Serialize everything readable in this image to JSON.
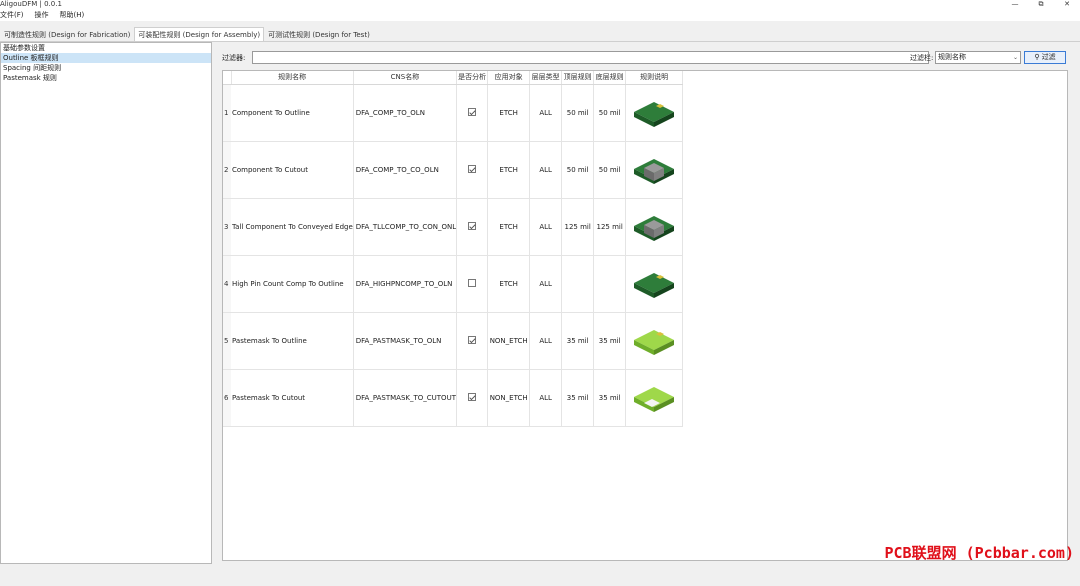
{
  "window": {
    "title": "AligouDFM | 0.0.1",
    "minimize": "—",
    "maximize": "⧉",
    "close": "✕"
  },
  "menu": [
    "文件(F)",
    "操作",
    "帮助(H)"
  ],
  "tabs": [
    {
      "label": "可制造性规则 (Design for Fabrication)",
      "active": false
    },
    {
      "label": "可装配性规则 (Design for Assembly)",
      "active": true
    },
    {
      "label": "可测试性规则 (Design for Test)",
      "active": false
    }
  ],
  "sidebar": {
    "items": [
      {
        "label": "基础参数设置",
        "selected": false
      },
      {
        "label": "Outline 板框规则",
        "selected": true
      },
      {
        "label": "Spacing 间距规则",
        "selected": false
      },
      {
        "label": "Pastemask 规则",
        "selected": false
      }
    ]
  },
  "filter": {
    "label": "过滤器:",
    "value": "",
    "column_label": "过滤栏:",
    "column_value": "规则名称",
    "button": "过滤"
  },
  "table": {
    "headers": [
      "规则名称",
      "CNS名称",
      "是否分析",
      "应用对象",
      "层层类型",
      "顶层规则",
      "底层规则",
      "规则说明"
    ],
    "rows": [
      {
        "num": "1",
        "name": "Component To Outline",
        "cns": "DFA_COMP_TO_OLN",
        "checked": true,
        "target": "ETCH",
        "layer": "ALL",
        "top": "50 mil",
        "bottom": "50 mil",
        "icon": "dark-green-board-icon"
      },
      {
        "num": "2",
        "name": "Component To Cutout",
        "cns": "DFA_COMP_TO_CO_OLN",
        "checked": true,
        "target": "ETCH",
        "layer": "ALL",
        "top": "50 mil",
        "bottom": "50 mil",
        "icon": "dark-green-board-chip-icon"
      },
      {
        "num": "3",
        "name": "Tall Component To Conveyed Edge",
        "cns": "DFA_TLLCOMP_TO_CON_ONL",
        "checked": true,
        "target": "ETCH",
        "layer": "ALL",
        "top": "125 mil",
        "bottom": "125 mil",
        "icon": "dark-green-board-chip-icon"
      },
      {
        "num": "4",
        "name": "High Pin Count Comp To Outline",
        "cns": "DFA_HIGHPNCOMP_TO_OLN",
        "checked": false,
        "target": "ETCH",
        "layer": "ALL",
        "top": "",
        "bottom": "",
        "icon": "dark-green-board-icon"
      },
      {
        "num": "5",
        "name": "Pastemask To Outline",
        "cns": "DFA_PASTMASK_TO_OLN",
        "checked": true,
        "target": "NON_ETCH",
        "layer": "ALL",
        "top": "35 mil",
        "bottom": "35 mil",
        "icon": "light-green-board-icon"
      },
      {
        "num": "6",
        "name": "Pastemask To Cutout",
        "cns": "DFA_PASTMASK_TO_CUTOUT",
        "checked": true,
        "target": "NON_ETCH",
        "layer": "ALL",
        "top": "35 mil",
        "bottom": "35 mil",
        "icon": "light-green-board-cutout-icon"
      }
    ]
  },
  "watermark": "PCB联盟网 (Pcbbar.com)"
}
